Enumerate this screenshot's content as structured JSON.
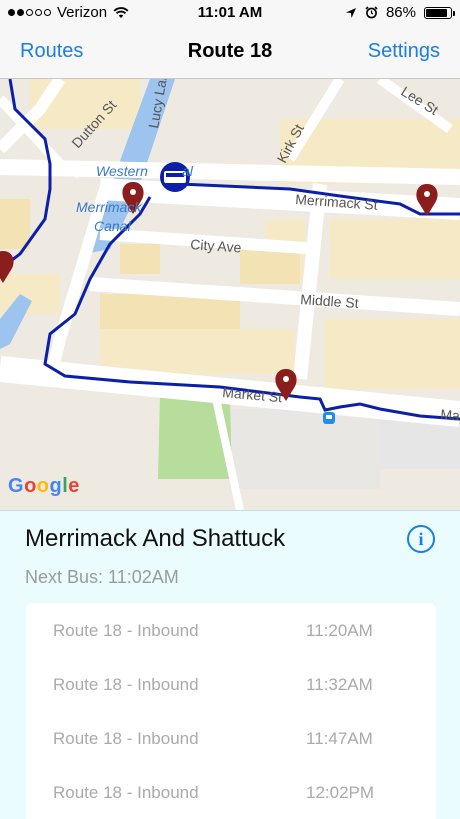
{
  "status_bar": {
    "carrier": "Verizon",
    "time": "11:01 AM",
    "battery": "86%"
  },
  "nav": {
    "left_label": "Routes",
    "title": "Route 18",
    "right_label": "Settings"
  },
  "map": {
    "streets": [
      "Dutton St",
      "Lucy Larcom Park",
      "Kirk St",
      "Lee St",
      "Merrimack St",
      "City Ave",
      "Middle St",
      "Market St"
    ],
    "places": [
      "Western Canal",
      "Merrimack Canal"
    ],
    "attribution": "Google",
    "route_color": "#0b1fa8",
    "marker_color": "#8b1d1d"
  },
  "stop": {
    "name": "Merrimack And Shattuck",
    "next_bus": "Next Bus: 11:02AM",
    "schedule": [
      {
        "route": "Route 18 - Inbound",
        "time": "11:20AM"
      },
      {
        "route": "Route 18 - Inbound",
        "time": "11:32AM"
      },
      {
        "route": "Route 18 - Inbound",
        "time": "11:47AM"
      },
      {
        "route": "Route 18 - Inbound",
        "time": "12:02PM"
      }
    ]
  }
}
